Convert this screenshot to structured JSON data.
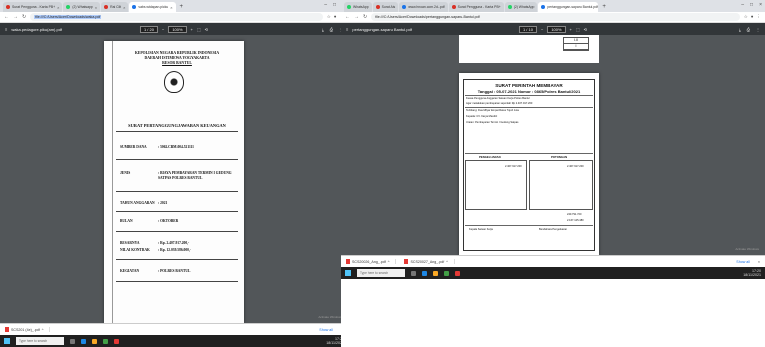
{
  "left": {
    "tabs": [
      {
        "label": "Surat Pengguna - Karta PB+",
        "active": false
      },
      {
        "label": "(2) Whatsapp",
        "active": false
      },
      {
        "label": "Rai Cilt",
        "active": false
      },
      {
        "label": "vabs.wtdapan.picku",
        "active": true
      }
    ],
    "url": "file:///C:/Users/Acer/Downloads/waka.pdf",
    "pdf": {
      "title": "waka.pedagore.piku(am).pdf",
      "page_info": "1 / 20",
      "zoom": "100%"
    },
    "doc": {
      "header": [
        "KEPOLISIAN NEGARA REPUBLIK INDONESIA",
        "DAERAH ISTIMEWA YOGYAKARTA",
        "RESOR BANTUL"
      ],
      "title": "SURAT PERTANGGUNGJAWABAN KEUANGAN",
      "rows": [
        {
          "key": "SUMBER DANA",
          "value": ": 5062.CBM.004.521111"
        },
        {
          "key": "JENIS",
          "value": ": BIAYA PEMBAYARAN TERMIN I GEDUNG SATPAS POLRES BANTUL"
        },
        {
          "key": "TAHUN ANGGARAN",
          "value": ": 2021"
        },
        {
          "key": "BULAN",
          "value": ": OKTOBER"
        },
        {
          "key": "BESARNYA",
          "value": ": Rp. 2.407.917.200,-"
        },
        {
          "key": "NILAI KONTRAK",
          "value": ": Rp. 12.039.586.000,-"
        },
        {
          "key": "KEGIATAN",
          "value": ": POLRES BANTUL"
        }
      ],
      "watermark": "Activate Windows"
    },
    "download": {
      "file": "SCS201 (4e)_.pdf",
      "show_all": "Show all"
    },
    "taskbar": {
      "search": "Type here to search",
      "time": "17:20",
      "date": "18/11/2021"
    }
  },
  "right": {
    "tabs": [
      {
        "label": "WhatsApp",
        "active": false
      },
      {
        "label": "Surat Ais",
        "active": false
      },
      {
        "label": "www.hnoan.com.2d-.pdf",
        "active": false
      },
      {
        "label": "Surat Pengguna - Karta PB+",
        "active": false
      },
      {
        "label": "(2) WhatsApp",
        "active": false
      },
      {
        "label": "pertanggungan-saparu Bantul.pdf",
        "active": true
      }
    ],
    "url": "file:///C:/Users/Acer/Downloads/pertanggungan-saparu-Bantul.pdf",
    "pdf": {
      "title": "pertanggungan-saparu Bantul.pdf",
      "page_info": "1 / 10",
      "zoom": "100%"
    },
    "top_table": [
      "I.II",
      "I"
    ],
    "receipt": {
      "title": "SURAT PERINTAH MEMBAYAR",
      "subtitle": "Tanggal : 05-07-2021    Nomor : 0865/Polres Bantul/2021",
      "lines": [
        "Kuasa Pengguna Anggaran Satuan Kerja Polres Bantul",
        "Agar melakukan pembayaran sejumlah Rp 2.407.917.200",
        "Terbilang: Dua Milyar Empat Ratus Tujuh Juta",
        "Kepada: CV. Karya Mandiri",
        "Uraian: Pembayaran Termin I Gedung Satpas"
      ],
      "section_left": "PENGELUARAN",
      "section_right": "POTONGAN",
      "amounts": [
        "2.407.917.200",
        "2.407.917.200",
        "240.791.720",
        "2.167.125.480"
      ],
      "footer": [
        "Kepala Satuan Kerja",
        "Bendahara Pengeluaran"
      ]
    },
    "watermark": "Activate Windows",
    "download": {
      "file1": "SCS20026_Ang_.pdf",
      "file2": "SCS20027_Ang_.pdf",
      "show_all": "Show all"
    },
    "taskbar": {
      "search": "Type here to search",
      "time": "17:20",
      "date": "18/11/2021"
    }
  }
}
